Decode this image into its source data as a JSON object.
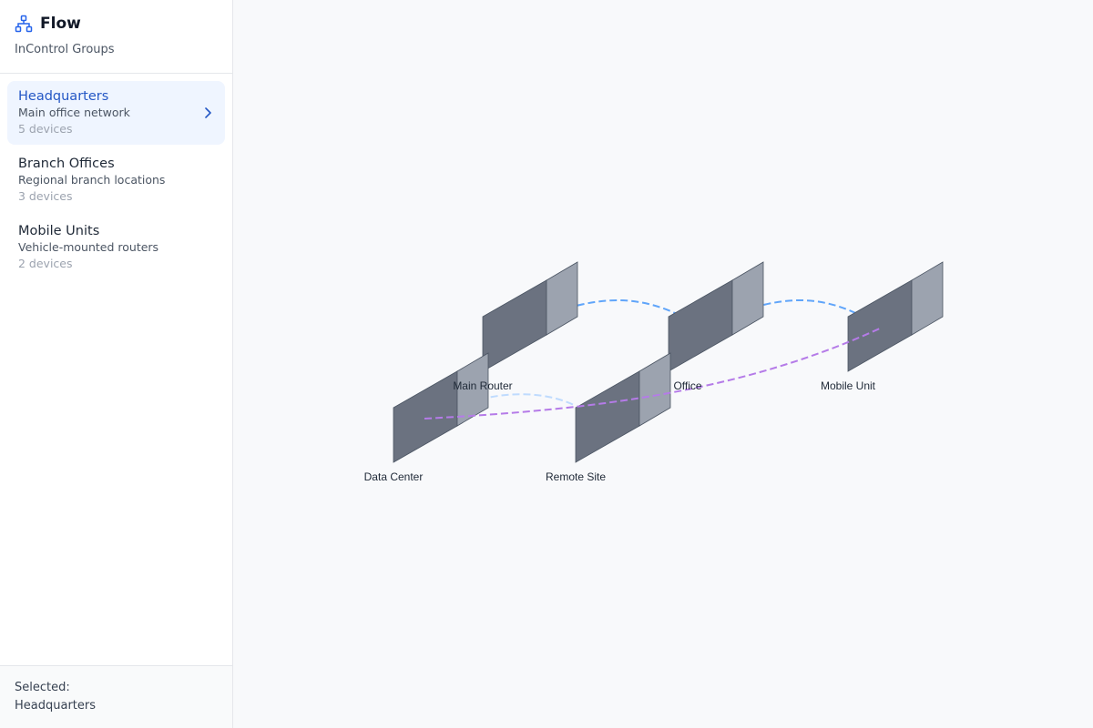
{
  "app": {
    "title": "Flow",
    "subtitle": "InControl Groups",
    "icon": "network-hierarchy-icon",
    "accent": "#2563eb"
  },
  "groups": [
    {
      "name": "Headquarters",
      "description": "Main office network",
      "count": "5 devices",
      "active": true
    },
    {
      "name": "Branch Offices",
      "description": "Regional branch locations",
      "count": "3 devices",
      "active": false
    },
    {
      "name": "Mobile Units",
      "description": "Vehicle-mounted routers",
      "count": "2 devices",
      "active": false
    }
  ],
  "footer": {
    "label": "Selected:",
    "value": "Headquarters"
  },
  "diagram": {
    "nodes": [
      {
        "id": "main-router",
        "label": "Main Router"
      },
      {
        "id": "office",
        "label": "Office"
      },
      {
        "id": "mobile-unit",
        "label": "Mobile Unit"
      },
      {
        "id": "data-center",
        "label": "Data Center"
      },
      {
        "id": "remote-site",
        "label": "Remote Site"
      }
    ],
    "links": [
      {
        "from": "main-router",
        "to": "office",
        "color": "#60a5fa"
      },
      {
        "from": "office",
        "to": "mobile-unit",
        "color": "#60a5fa"
      },
      {
        "from": "data-center",
        "to": "remote-site",
        "color": "#bfdbfe"
      },
      {
        "from": "data-center",
        "to": "mobile-unit",
        "color": "#b57be8"
      }
    ],
    "device_colors": {
      "front": "#6b7280",
      "side": "#9ca3af",
      "stroke": "#4b5563"
    }
  }
}
